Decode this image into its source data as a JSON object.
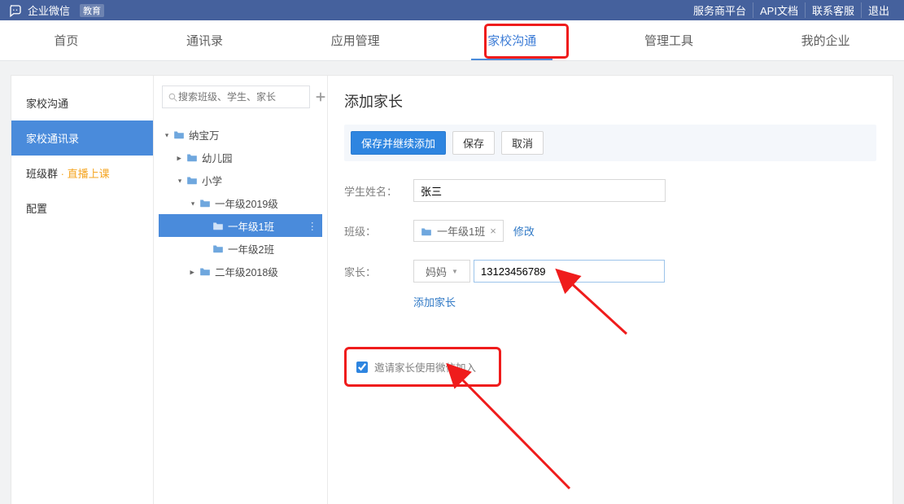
{
  "topbar": {
    "brand": "企业微信",
    "brand_badge": "教育",
    "links": [
      "服务商平台",
      "API文档",
      "联系客服",
      "退出"
    ]
  },
  "nav": {
    "items": [
      "首页",
      "通讯录",
      "应用管理",
      "家校沟通",
      "管理工具",
      "我的企业"
    ],
    "active_index": 3
  },
  "sidebar": {
    "items": [
      {
        "label": "家校沟通",
        "active": false
      },
      {
        "label": "家校通讯录",
        "active": true
      },
      {
        "label": "班级群",
        "suffix": "直播上课",
        "active": false
      },
      {
        "label": "配置",
        "active": false
      }
    ]
  },
  "tree": {
    "search_placeholder": "搜索班级、学生、家长",
    "nodes": [
      {
        "label": "纳宝万",
        "depth": 0,
        "expanded": true
      },
      {
        "label": "幼儿园",
        "depth": 1,
        "collapsed": true
      },
      {
        "label": "小学",
        "depth": 1,
        "expanded": true
      },
      {
        "label": "一年级2019级",
        "depth": 2,
        "expanded": true
      },
      {
        "label": "一年级1班",
        "depth": 3,
        "selected": true,
        "leaf": true
      },
      {
        "label": "一年级2班",
        "depth": 3,
        "leaf": true
      },
      {
        "label": "二年级2018级",
        "depth": 2,
        "collapsed": true
      }
    ]
  },
  "form": {
    "title": "添加家长",
    "buttons": {
      "save_add": "保存并继续添加",
      "save": "保存",
      "cancel": "取消"
    },
    "labels": {
      "student_name": "学生姓名：",
      "class": "班级：",
      "parent": "家长："
    },
    "student_name_value": "张三",
    "class_tag": "一年级1班",
    "modify_text": "修改",
    "parent_select": "妈妈",
    "parent_phone": "13123456789",
    "add_parent_link": "添加家长",
    "invite_label": "邀请家长使用微信加入",
    "invite_checked": true
  }
}
